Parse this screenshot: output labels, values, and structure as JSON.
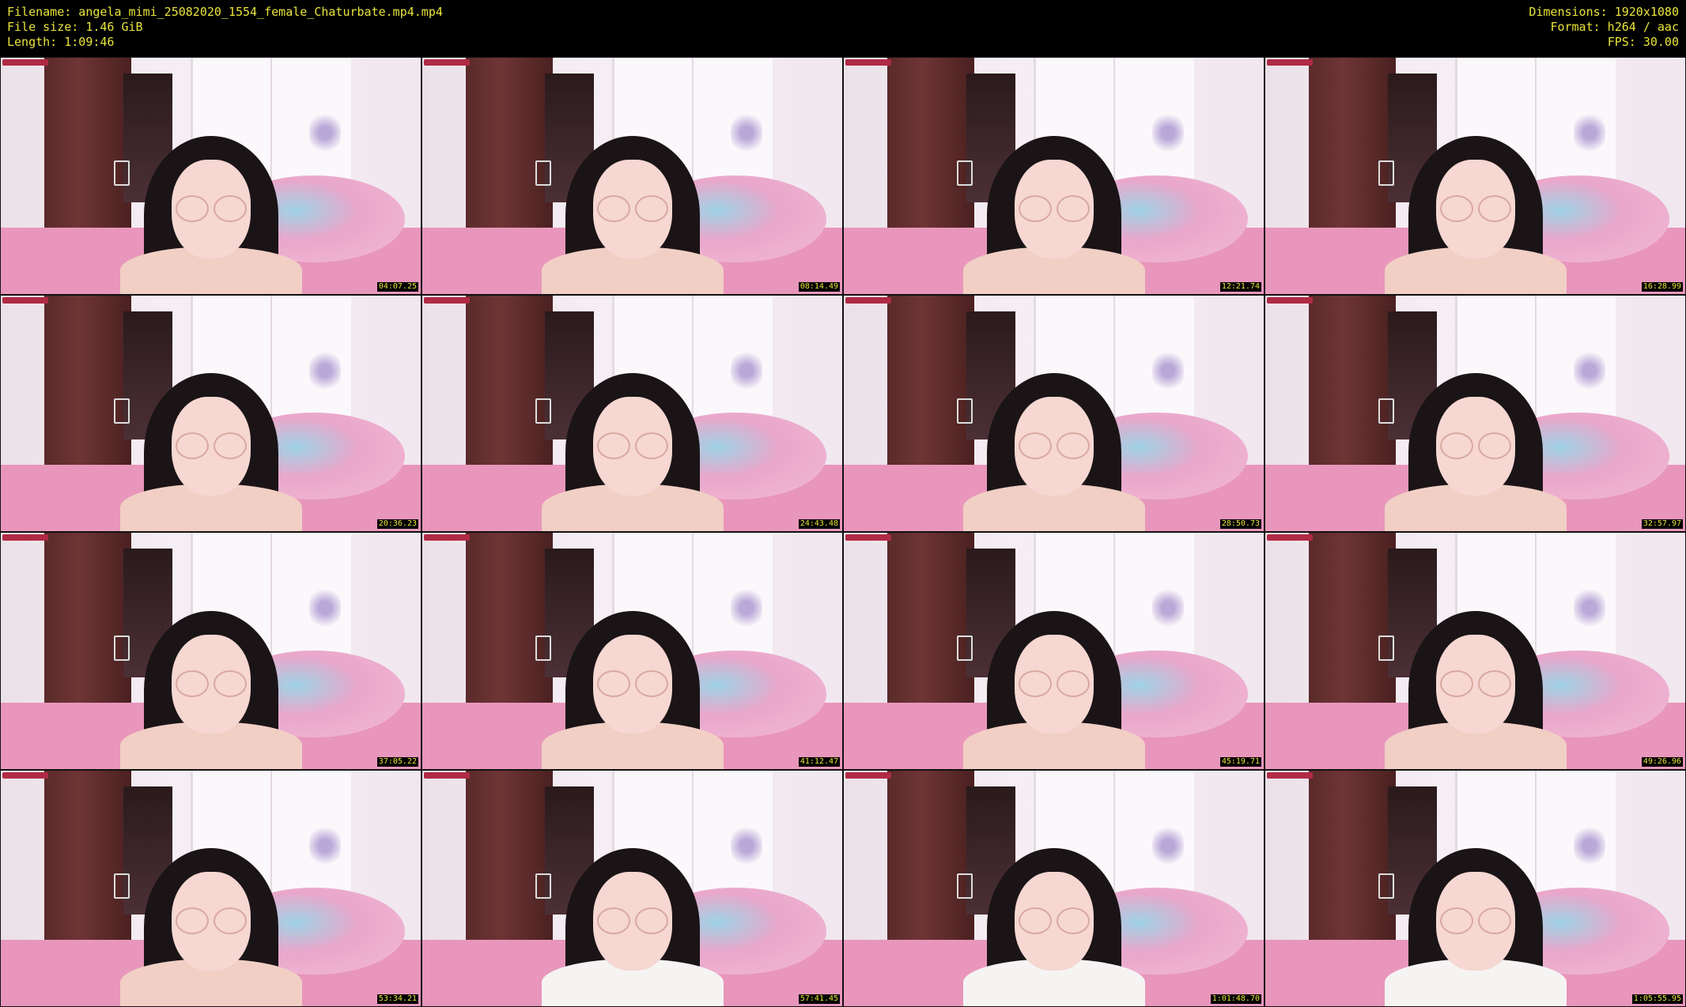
{
  "header": {
    "filename": "Filename: angela_mimi_25082020_1554_female_Chaturbate.mp4.mp4",
    "filesize": "File size: 1.46 GiB",
    "length": "Length: 1:09:46",
    "dimensions": "Dimensions: 1920x1080",
    "format": "Format: h264 / aac",
    "fps": "FPS: 30.00"
  },
  "thumbnails": [
    {
      "timestamp": "04:07.25",
      "shirt": false
    },
    {
      "timestamp": "08:14.49",
      "shirt": false
    },
    {
      "timestamp": "12:21.74",
      "shirt": false
    },
    {
      "timestamp": "16:28.99",
      "shirt": false
    },
    {
      "timestamp": "20:36.23",
      "shirt": false
    },
    {
      "timestamp": "24:43.48",
      "shirt": false
    },
    {
      "timestamp": "28:50.73",
      "shirt": false
    },
    {
      "timestamp": "32:57.97",
      "shirt": false
    },
    {
      "timestamp": "37:05.22",
      "shirt": false
    },
    {
      "timestamp": "41:12.47",
      "shirt": false
    },
    {
      "timestamp": "45:19.71",
      "shirt": false
    },
    {
      "timestamp": "49:26.96",
      "shirt": false
    },
    {
      "timestamp": "53:34.21",
      "shirt": false
    },
    {
      "timestamp": "57:41.45",
      "shirt": true
    },
    {
      "timestamp": "1:01:48.70",
      "shirt": true
    },
    {
      "timestamp": "1:05:55.95",
      "shirt": true
    }
  ]
}
